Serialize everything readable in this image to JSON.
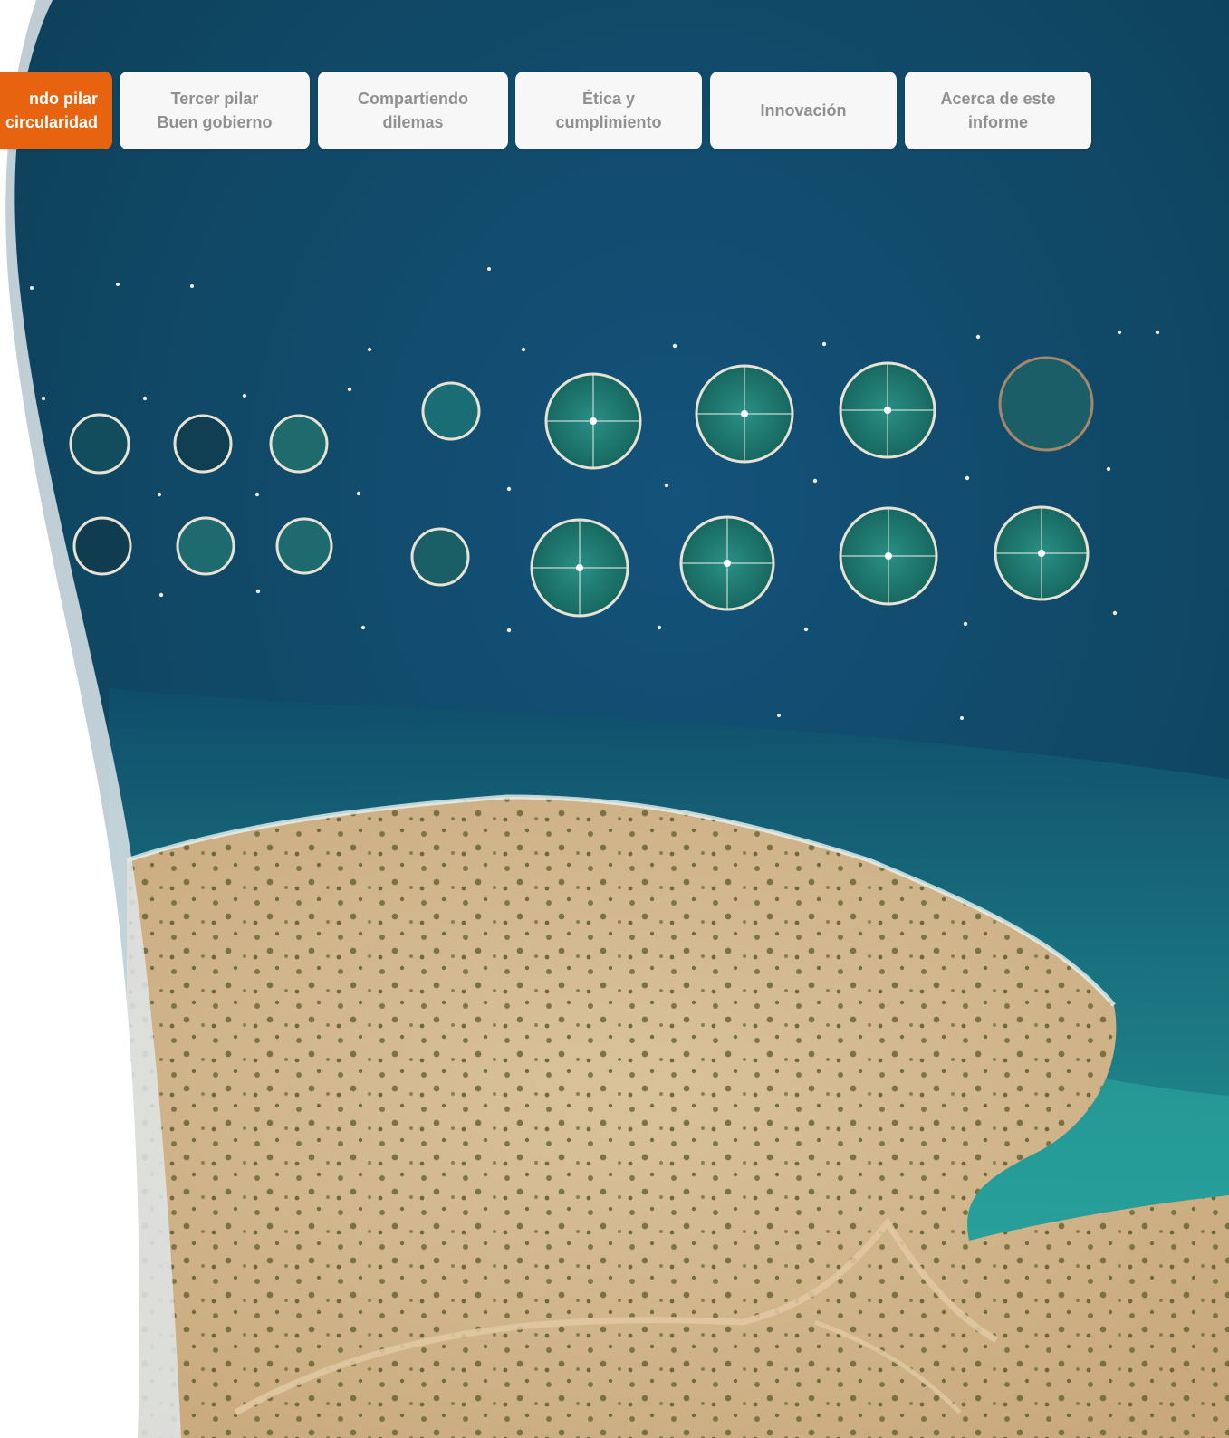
{
  "nav": {
    "tabs": [
      {
        "line1": "ndo pilar",
        "line2": "circularidad",
        "active": true
      },
      {
        "line1": "Tercer pilar",
        "line2": "Buen gobierno",
        "active": false
      },
      {
        "line1": "Compartiendo",
        "line2": "dilemas",
        "active": false
      },
      {
        "line1": "Ética y",
        "line2": "cumplimiento",
        "active": false
      },
      {
        "line1": "Innovación",
        "line2": "",
        "active": false
      },
      {
        "line1": "Acerca de este",
        "line2": "informe",
        "active": false
      }
    ]
  },
  "colors": {
    "accent": "#e8630f",
    "tab_background": "#f7f7f7",
    "tab_text": "#909090",
    "sea_deep": "#0f4561",
    "sea_shallow": "#2fb4a5",
    "land": "#d3b890",
    "panel": "#ffffff"
  },
  "image": {
    "description_icon": "aerial-fish-farm-photo"
  }
}
